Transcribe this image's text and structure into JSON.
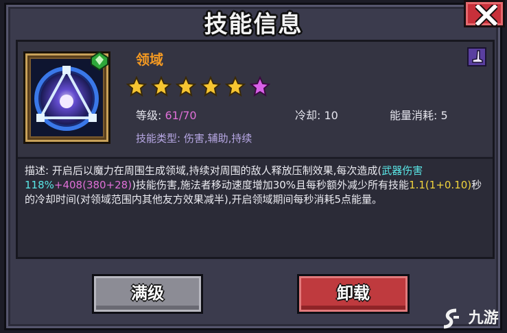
{
  "dialog": {
    "title": "技能信息",
    "close_icon": "close-icon"
  },
  "skill": {
    "name": "领域",
    "icon": "magic-triangle-icon",
    "element_badge": "green-gem-icon",
    "category_icon": "purple-boot-icon",
    "stars": {
      "total": 6,
      "gold": 5,
      "purple": 1
    },
    "level_label": "等级:",
    "level_value": "61/70",
    "cooldown_label": "冷却:",
    "cooldown_value": "10",
    "energy_label": "能量消耗:",
    "energy_value": "5",
    "type_line": "技能类型: 伤害,辅助,持续"
  },
  "description": {
    "seg1": "描述: 开启后以魔力在周围生成领域,持续对周围的敌人释放压制效果,每次造成(",
    "seg2": "武器伤害118%",
    "seg3": "+408(380+28)",
    "seg4": ")技能伤害,施法者移动速度增加30%且每秒额外减少所有技能",
    "seg5": "1.1(1+0.10)",
    "seg6": "秒的冷却时间(对领域范围内其他友方效果减半),开启领域期间每秒消耗5点能量。"
  },
  "buttons": {
    "max_label": "满级",
    "unequip_label": "卸载"
  },
  "watermark": {
    "text": "九游"
  },
  "colors": {
    "skill_name": "#f59a22",
    "highlight_cyan": "#5ae8e8",
    "highlight_pink": "#e070d8",
    "highlight_yellow": "#f2d53c",
    "button_gray": "#8c8c95",
    "button_red": "#bf3a3e"
  }
}
